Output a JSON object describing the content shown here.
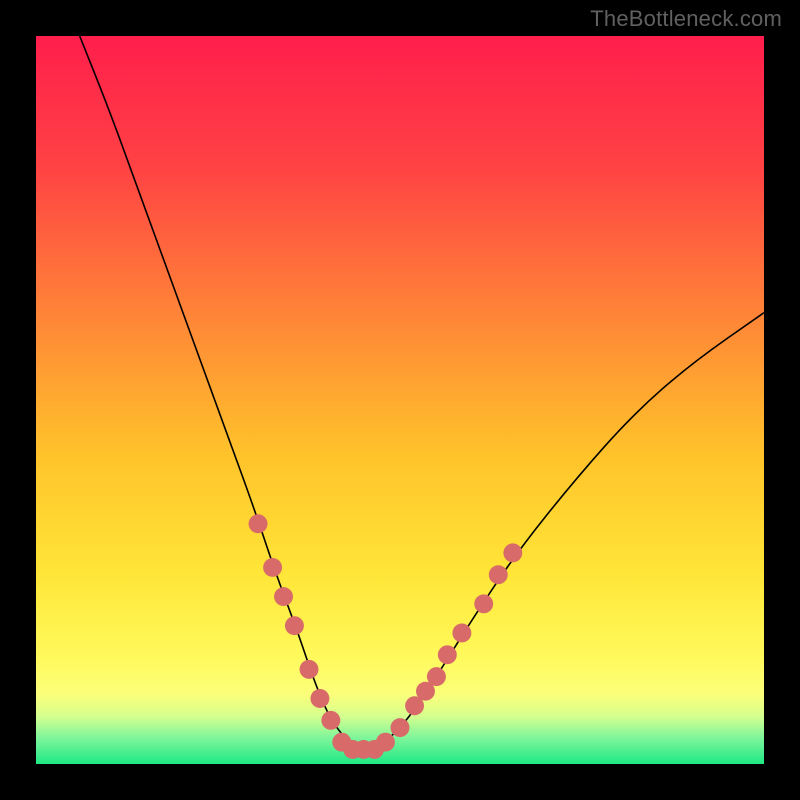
{
  "attribution": "TheBottleneck.com",
  "chart_data": {
    "type": "line",
    "title": "",
    "xlabel": "",
    "ylabel": "",
    "xlim": [
      0,
      100
    ],
    "ylim": [
      0,
      100
    ],
    "grid": false,
    "series": [
      {
        "name": "bottleneck-curve",
        "x": [
          6,
          10,
          14,
          18,
          22,
          26,
          30,
          33,
          36,
          38,
          40,
          42,
          44,
          46,
          48,
          51,
          55,
          60,
          66,
          74,
          82,
          90,
          100
        ],
        "y": [
          100,
          90,
          79,
          68,
          57,
          46,
          35,
          26,
          18,
          12,
          7,
          4,
          2,
          2,
          3,
          6,
          12,
          20,
          29,
          39,
          48,
          55,
          62
        ]
      }
    ],
    "markers": [
      {
        "x": 30.5,
        "y": 33
      },
      {
        "x": 32.5,
        "y": 27
      },
      {
        "x": 34.0,
        "y": 23
      },
      {
        "x": 35.5,
        "y": 19
      },
      {
        "x": 37.5,
        "y": 13
      },
      {
        "x": 39.0,
        "y": 9
      },
      {
        "x": 40.5,
        "y": 6
      },
      {
        "x": 42.0,
        "y": 3
      },
      {
        "x": 43.5,
        "y": 2
      },
      {
        "x": 45.0,
        "y": 2
      },
      {
        "x": 46.5,
        "y": 2
      },
      {
        "x": 48.0,
        "y": 3
      },
      {
        "x": 50.0,
        "y": 5
      },
      {
        "x": 52.0,
        "y": 8
      },
      {
        "x": 53.5,
        "y": 10
      },
      {
        "x": 55.0,
        "y": 12
      },
      {
        "x": 56.5,
        "y": 15
      },
      {
        "x": 58.5,
        "y": 18
      },
      {
        "x": 61.5,
        "y": 22
      },
      {
        "x": 63.5,
        "y": 26
      },
      {
        "x": 65.5,
        "y": 29
      }
    ],
    "gradient_stops": [
      {
        "offset": 0.0,
        "color": "#ff1e4c"
      },
      {
        "offset": 0.18,
        "color": "#ff4244"
      },
      {
        "offset": 0.4,
        "color": "#ff8a36"
      },
      {
        "offset": 0.58,
        "color": "#ffc42a"
      },
      {
        "offset": 0.74,
        "color": "#ffe638"
      },
      {
        "offset": 0.85,
        "color": "#fff95a"
      },
      {
        "offset": 0.905,
        "color": "#fbff7a"
      },
      {
        "offset": 0.935,
        "color": "#d4ff8f"
      },
      {
        "offset": 0.965,
        "color": "#7cf59a"
      },
      {
        "offset": 1.0,
        "color": "#1ee884"
      }
    ],
    "marker_color": "#d86a6a",
    "curve_color": "#000000"
  }
}
